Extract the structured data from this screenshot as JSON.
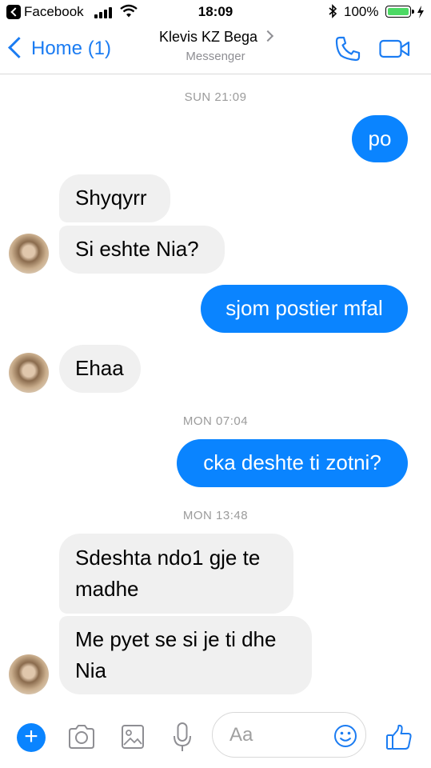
{
  "status_bar": {
    "back_app": "Facebook",
    "time": "18:09",
    "battery_percent": "100%",
    "battery_level": 1.0,
    "icons": [
      "back-to-app-icon",
      "signal-bars-icon",
      "wifi-icon",
      "bluetooth-icon",
      "battery-icon",
      "charging-bolt-icon"
    ]
  },
  "nav": {
    "back_label": "Home (1)",
    "title": "Klevis KZ Bega",
    "subtitle": "Messenger",
    "icons": [
      "phone-icon",
      "video-camera-icon"
    ],
    "accent_color": "#1b7cf2"
  },
  "messages": {
    "ts1": "SUN 21:09",
    "m1": "po",
    "m2": "Shyqyrr",
    "m3": "Si eshte Nia?",
    "m4": "sjom postier mfal",
    "m5": "Ehaa",
    "ts2": "MON 07:04",
    "m6": "cka deshte ti zotni?",
    "ts3": "MON 13:48",
    "m7_l1": "Sdeshta ndo1 gje te",
    "m7_l2": "madhe",
    "m8_l1": "Me pyet se si je ti dhe",
    "m8_l2": "Nia",
    "outgoing_color": "#0a84ff",
    "incoming_color": "#f0f0f0"
  },
  "composer": {
    "placeholder": "Aa",
    "icons": [
      "plus-icon",
      "camera-icon",
      "image-icon",
      "microphone-icon",
      "emoji-icon",
      "thumbs-up-icon"
    ]
  }
}
